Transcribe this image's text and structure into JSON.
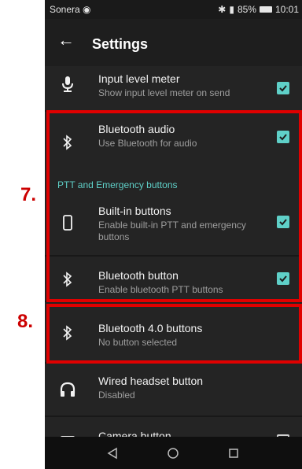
{
  "callouts": {
    "seven": "7.",
    "eight": "8."
  },
  "status_bar": {
    "carrier": "Sonera",
    "battery": "85%",
    "time": "10:01"
  },
  "header": {
    "title": "Settings"
  },
  "rows": [
    {
      "title": "Input level meter",
      "subtitle": "Show input level meter on send",
      "icon": "microphone-icon",
      "checked": true
    },
    {
      "title": "Bluetooth audio",
      "subtitle": "Use Bluetooth for audio",
      "icon": "bluetooth-icon",
      "checked": true
    },
    {
      "title": "Built-in buttons",
      "subtitle": "Enable built-in PTT and emergency buttons",
      "icon": "phone-device-icon",
      "checked": true
    },
    {
      "title": "Bluetooth button",
      "subtitle": "Enable bluetooth PTT buttons",
      "icon": "bluetooth-icon",
      "checked": true
    },
    {
      "title": "Bluetooth 4.0 buttons",
      "subtitle": "No button selected",
      "icon": "bluetooth-icon"
    },
    {
      "title": "Wired headset button",
      "subtitle": "Disabled",
      "icon": "headphones-icon"
    },
    {
      "title": "Camera button",
      "subtitle": "",
      "icon": "camera-icon",
      "checked": false
    }
  ],
  "section_header": "PTT and Emergency buttons",
  "colors": {
    "accent": "#5fd0c8",
    "highlight": "#e00000",
    "callout": "#cc0000",
    "background": "#1e1e1e"
  }
}
